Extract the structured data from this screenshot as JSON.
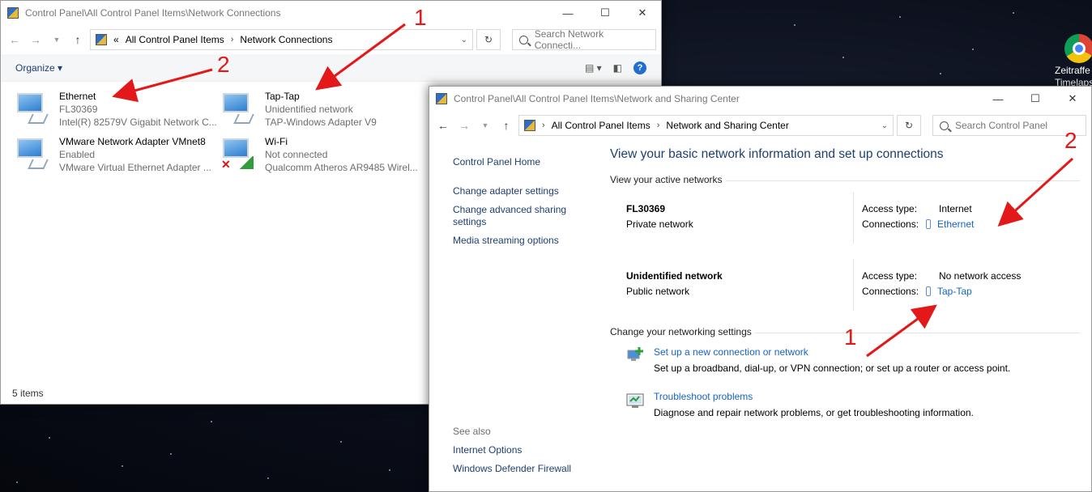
{
  "desktop": {
    "icon_name": "chrome-icon",
    "label_line1": "Zeitraffe",
    "label_line2": "Timelaps"
  },
  "netconn": {
    "title": "Control Panel\\All Control Panel Items\\Network Connections",
    "address": {
      "overflow": "«",
      "crumb1": "All Control Panel Items",
      "crumb2": "Network Connections"
    },
    "search_placeholder": "Search Network Connecti...",
    "organize": "Organize",
    "adapters": [
      {
        "name": "Ethernet",
        "status": "FL30369",
        "device": "Intel(R) 82579V Gigabit Network C..."
      },
      {
        "name": "Tap-Tap",
        "status": "Unidentified network",
        "device": "TAP-Windows Adapter V9"
      },
      {
        "name": "VMware Network Adapter VMnet8",
        "status": "Enabled",
        "device": "VMware Virtual Ethernet Adapter ..."
      },
      {
        "name": "Wi-Fi",
        "status": "Not connected",
        "device": "Qualcomm Atheros AR9485 Wirel..."
      }
    ],
    "status_bar": "5 items"
  },
  "nsc": {
    "title": "Control Panel\\All Control Panel Items\\Network and Sharing Center",
    "address": {
      "crumb1": "All Control Panel Items",
      "crumb2": "Network and Sharing Center"
    },
    "search_placeholder": "Search Control Panel",
    "sidebar": {
      "home": "Control Panel Home",
      "adapter": "Change adapter settings",
      "advanced_1": "Change advanced sharing",
      "advanced_2": "settings",
      "media": "Media streaming options",
      "see_also": "See also",
      "internet_options": "Internet Options",
      "firewall": "Windows Defender Firewall"
    },
    "heading": "View your basic network information and set up connections",
    "active_label": "View your active networks",
    "networks": [
      {
        "name": "FL30369",
        "type": "Private network",
        "access_label": "Access type:",
        "access": "Internet",
        "conn_label": "Connections:",
        "conn": "Ethernet"
      },
      {
        "name": "Unidentified network",
        "type": "Public network",
        "access_label": "Access type:",
        "access": "No network access",
        "conn_label": "Connections:",
        "conn": "Tap-Tap"
      }
    ],
    "change_label": "Change your networking settings",
    "settings": [
      {
        "link": "Set up a new connection or network",
        "desc": "Set up a broadband, dial-up, or VPN connection; or set up a router or access point."
      },
      {
        "link": "Troubleshoot problems",
        "desc": "Diagnose and repair network problems, or get troubleshooting information."
      }
    ]
  },
  "annotations": {
    "one": "1",
    "two": "2",
    "color": "#e31818"
  }
}
